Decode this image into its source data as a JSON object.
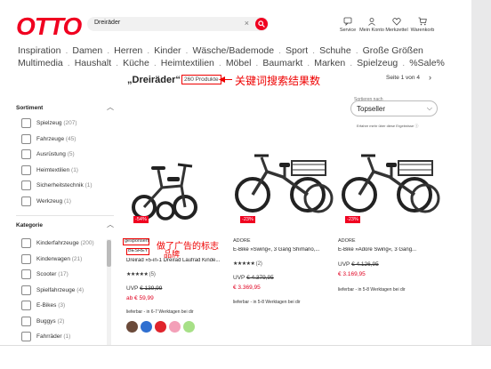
{
  "header": {
    "logo": "OTTO",
    "search": {
      "value": "Dreiräder",
      "clear": "×"
    },
    "icons": [
      {
        "label": "Service",
        "icon": "chat-icon"
      },
      {
        "label": "Mein Konto",
        "icon": "account-icon"
      },
      {
        "label": "Merkzettel",
        "icon": "heart-icon"
      },
      {
        "label": "Warenkorb",
        "icon": "cart-icon"
      }
    ]
  },
  "nav": {
    "row1": [
      "Inspiration",
      "Damen",
      "Herren",
      "Kinder",
      "Wäsche/Bademode",
      "Sport",
      "Schuhe",
      "Große Größen"
    ],
    "row2": [
      "Multimedia",
      "Haushalt",
      "Küche",
      "Heimtextilien",
      "Möbel",
      "Baumarkt",
      "Marken",
      "Spielzeug",
      "%Sale%"
    ]
  },
  "results": {
    "title": "„Dreiräder“",
    "count": "260 Produkte",
    "annotation": "关键词搜索结果数",
    "page_info": "Seite 1 von 4",
    "next": "›"
  },
  "sort": {
    "label": "Sortieren nach",
    "value": "Topseller",
    "note": "Erfahre mehr über diese Ergebnisse ⓘ"
  },
  "sidebar": {
    "sortiment": {
      "heading": "Sortiment",
      "items": [
        {
          "label": "Spielzeug",
          "count": "(207)"
        },
        {
          "label": "Fahrzeuge",
          "count": "(45)"
        },
        {
          "label": "Ausrüstung",
          "count": "(5)"
        },
        {
          "label": "Heimtextilien",
          "count": "(1)"
        },
        {
          "label": "Sicherheitstechnik",
          "count": "(1)"
        },
        {
          "label": "Werkzeug",
          "count": "(1)"
        }
      ]
    },
    "kategorie": {
      "heading": "Kategorie",
      "items": [
        {
          "label": "Kinderfahrzeuge",
          "count": "(200)"
        },
        {
          "label": "Kinderwagen",
          "count": "(21)"
        },
        {
          "label": "Scooter",
          "count": "(17)"
        },
        {
          "label": "Spielfahrzeuge",
          "count": "(4)"
        },
        {
          "label": "E-Bikes",
          "count": "(3)"
        },
        {
          "label": "Buggys",
          "count": "(2)"
        },
        {
          "label": "Fahrräder",
          "count": "(1)"
        }
      ]
    }
  },
  "products": [
    {
      "sponsored": "gesponsert",
      "brand": "BESREY",
      "name": "Dreirad »5-in-1 Dreirad Laufrad Kinde...",
      "stars": "★★★★★",
      "reviews": "(5)",
      "old_price_prefix": "UVP ",
      "old_price": "€ 139,99",
      "new_price": "ab € 59,99",
      "badge": "-54%",
      "delivery": "lieferbar - in 6-7 Werktagen bei dir",
      "swatches": [
        "#6b4a3a",
        "#2f6fd0",
        "#e0242c",
        "#f3a0b8",
        "#a7e087"
      ]
    },
    {
      "brand": "ADORE",
      "name": "E-Bike »Swing«, 3 Gang Shimano,...",
      "stars": "★★★★★",
      "reviews": "(2)",
      "old_price_prefix": "UVP ",
      "old_price": "€ 4.379,95",
      "new_price": "€ 3.369,95",
      "badge": "-23%",
      "delivery": "lieferbar - in 5-8 Werktagen bei dir"
    },
    {
      "brand": "ADORE",
      "name": "E-Bike »Adore Swing«, 3 Gang...",
      "old_price_prefix": "UVP ",
      "old_price": "€ 4.126,95",
      "new_price": "€ 3.169,95",
      "badge": "-23%",
      "delivery": "lieferbar - in 5-8 Werktagen bei dir"
    }
  ],
  "annotations": {
    "ad_label": "做了广告的标志",
    "brand_label": "品牌"
  }
}
